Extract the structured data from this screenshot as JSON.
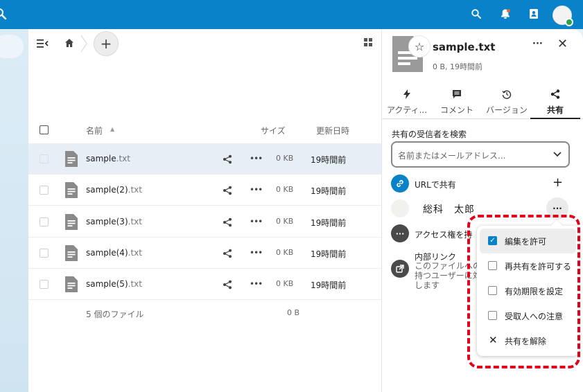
{
  "topbar": {
    "icons": [
      "search-icon",
      "bell-icon",
      "contacts-icon"
    ],
    "accent_color": "#0a82c9"
  },
  "files": {
    "header": {
      "name": "名前",
      "size": "サイズ",
      "modified": "更新日時"
    },
    "rows": [
      {
        "base": "sample",
        "ext": ".txt",
        "size": "0 KB",
        "modified": "19時間前",
        "selected": true
      },
      {
        "base": "sample(2)",
        "ext": ".txt",
        "size": "0 KB",
        "modified": "19時間前"
      },
      {
        "base": "sample(3)",
        "ext": ".txt",
        "size": "0 KB",
        "modified": "19時間前"
      },
      {
        "base": "sample(4)",
        "ext": ".txt",
        "size": "0 KB",
        "modified": "19時間前"
      },
      {
        "base": "sample(5)",
        "ext": ".txt",
        "size": "0 KB",
        "modified": "19時間前"
      }
    ],
    "summary": {
      "count": "5 個のファイル",
      "total": "0 B"
    }
  },
  "sidebar": {
    "title": "sample.txt",
    "subtitle": "0 B, 19時間前",
    "tabs": [
      {
        "label": "アクティ...",
        "icon": "activity-icon"
      },
      {
        "label": "コメント",
        "icon": "comment-icon"
      },
      {
        "label": "バージョン",
        "icon": "history-icon"
      },
      {
        "label": "共有",
        "icon": "share-icon",
        "active": true
      }
    ],
    "share_search_label": "共有の受信者を検索",
    "share_search_placeholder": "名前またはメールアドレス...",
    "url_share_label": "URLで共有",
    "user_name": "総科　太郎",
    "access_label": "アクセス権を持",
    "internal_link_title": "内部リンク",
    "internal_link_desc": [
      "このファイルへの",
      "持つユーザーに対",
      "します"
    ]
  },
  "popup": {
    "items": [
      {
        "label": "編集を許可",
        "type": "checkbox",
        "checked": true
      },
      {
        "label": "再共有を許可する",
        "type": "checkbox",
        "checked": false
      },
      {
        "label": "有効期限を設定",
        "type": "checkbox",
        "checked": false
      },
      {
        "label": "受取人への注意",
        "type": "checkbox",
        "checked": false
      },
      {
        "label": "共有を解除",
        "type": "action"
      }
    ],
    "highlight_color": "#e3001b"
  }
}
